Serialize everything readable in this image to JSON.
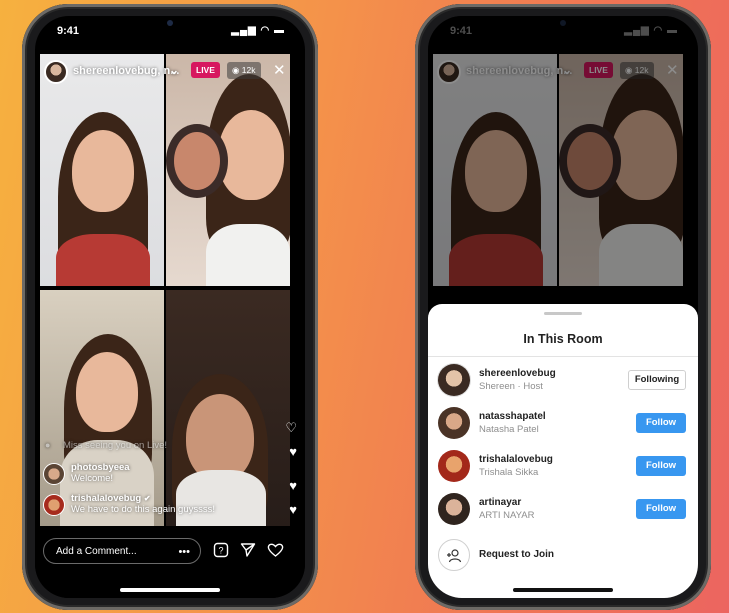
{
  "colors": {
    "live_badge": "#d7175f",
    "follow_button": "#3897f0",
    "background_left": "#f6b13f",
    "background_right": "#ec6560"
  },
  "left_phone": {
    "status": {
      "time": "9:41",
      "indicators": "▂▄▆ ◠ ▬"
    },
    "header": {
      "username": "shereenlovebug, n...",
      "chevron": "⌄",
      "live_label": "LIVE",
      "viewers": "12k",
      "viewers_icon": "eye-icon",
      "close": "✕"
    },
    "comments": [
      {
        "text": "Miss seeing you on Live!"
      },
      {
        "username": "photosbyeea",
        "text": "Welcome!"
      },
      {
        "username": "trishalalovebug",
        "text": "We have to do this again guyssss!",
        "verified": true
      }
    ],
    "comment_bar": {
      "placeholder": "Add a Comment...",
      "more": "•••"
    },
    "actions": [
      "question-icon",
      "send-icon",
      "heart-icon"
    ]
  },
  "right_phone": {
    "status": {
      "time": "9:41",
      "indicators": "▂▄▆ ◠ ▬"
    },
    "header": {
      "username": "shereenlovebug, n...",
      "chevron": "⌄",
      "live_label": "LIVE",
      "viewers": "12k",
      "close": "✕"
    },
    "sheet": {
      "title": "In This Room",
      "members": [
        {
          "username": "shereenlovebug",
          "subtitle": "Shereen · Host",
          "button": "Following"
        },
        {
          "username": "natasshapatel",
          "subtitle": "Natasha Patel",
          "button": "Follow"
        },
        {
          "username": "trishalalovebug",
          "subtitle": "Trishala Sikka",
          "button": "Follow"
        },
        {
          "username": "artinayar",
          "subtitle": "ARTI NAYAR",
          "button": "Follow"
        }
      ],
      "request": {
        "label": "Request to Join",
        "icon": "add-person-icon"
      }
    }
  }
}
